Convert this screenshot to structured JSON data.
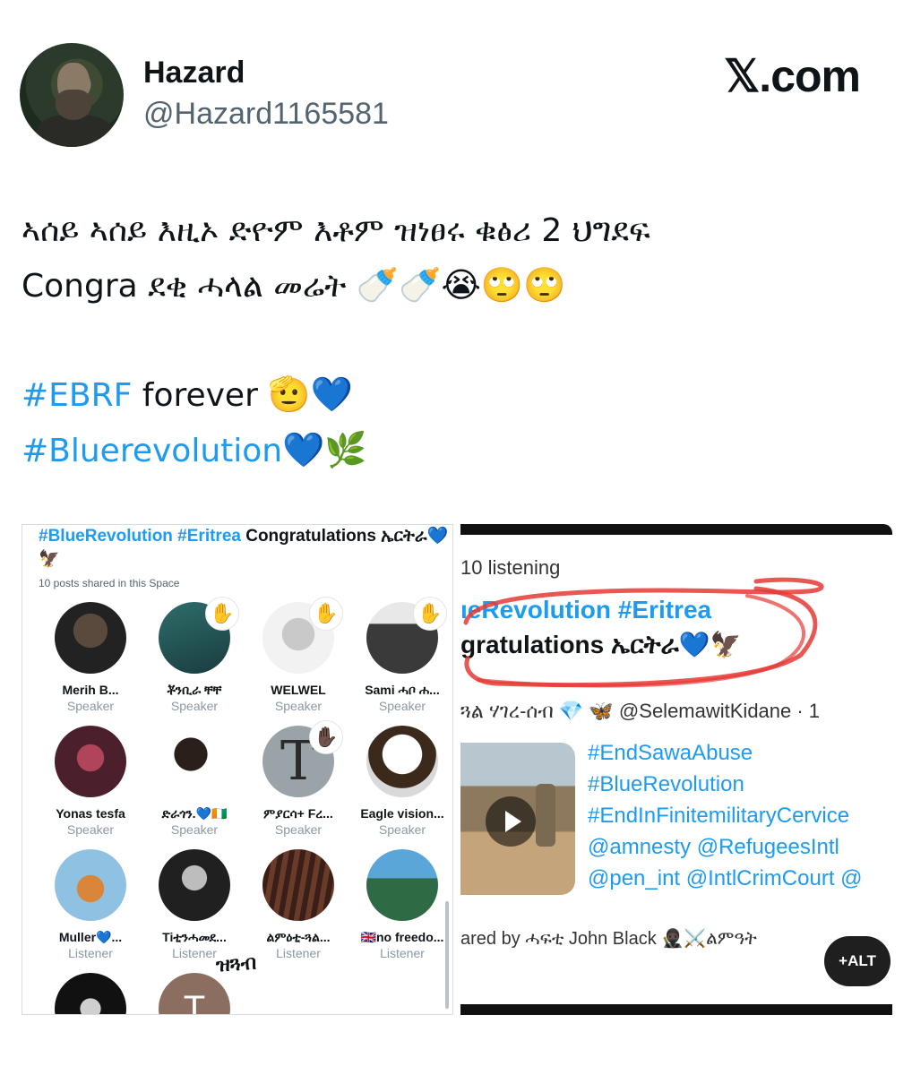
{
  "author": {
    "name": "Hazard",
    "handle": "@Hazard1165581"
  },
  "source_logo": "𝕏.com",
  "tweet": {
    "line1": "ኣሰይ ኣሰይ እዚኦ ድዮም እቶም ዝነፀሩ ቁፅሪ 2 ህግደፍ",
    "line2_text": "Congra ደቂ ሓላል መሬት",
    "line2_emoji": "🍼🍼😭🙄🙄",
    "hashtag1": "#EBRF",
    "forever": " forever ",
    "line3_emoji": "🫡💙",
    "hashtag2": "#Bluerevolution",
    "line4_emoji": "💙🌿"
  },
  "space_screenshot": {
    "title_tags": "#BlueRevolution #Eritrea",
    "title_rest": " Congratulations ኤርትራ💙🦅",
    "subtitle": "10 posts shared in this Space",
    "participants": [
      {
        "name": "Merih B...",
        "role": "Speaker",
        "verified": true
      },
      {
        "name": "ቾንቢራ ቸቸ",
        "role": "Speaker",
        "verified": true
      },
      {
        "name": "WELWEL",
        "role": "Speaker"
      },
      {
        "name": "Sami ሓቦ ሐ...",
        "role": "Speaker"
      },
      {
        "name": "Yonas tesfa",
        "role": "Speaker"
      },
      {
        "name": "ድራጎን.💙🇨🇮",
        "role": "Speaker"
      },
      {
        "name": "ምያርሳ+ Fረ...",
        "role": "Speaker"
      },
      {
        "name": "Eagle vision...",
        "role": "Speaker"
      },
      {
        "name": "Muller💙...",
        "role": "Listener"
      },
      {
        "name": "Tiቲንሓመደ...",
        "role": "Listener"
      },
      {
        "name": "ልምዕቲ-ጓል...",
        "role": "Listener"
      },
      {
        "name": "🇬🇧no freedo...",
        "role": "Listener"
      }
    ],
    "signature": "ዝጓብ"
  },
  "spaces_screenshot": {
    "listening": "10 listening",
    "tags": "ıeRevolution #Eritrea",
    "congrats": "gratulations ኤርትራ💙🦅",
    "user_line": "ጓል ሃገረ-ሰብ 💎 🦋 @SelemawitKidane · 1",
    "links": [
      "#EndSawaAbuse",
      "#BlueRevolution",
      "#EndInFinitemilitaryCervice",
      "@amnesty @RefugeesIntl",
      "@pen_int @IntlCrimCourt @"
    ],
    "shared_by": "ared by ሓፍቲ John Black 🥷🏿⚔️ልምዓት",
    "alt_button": "+ALT"
  }
}
